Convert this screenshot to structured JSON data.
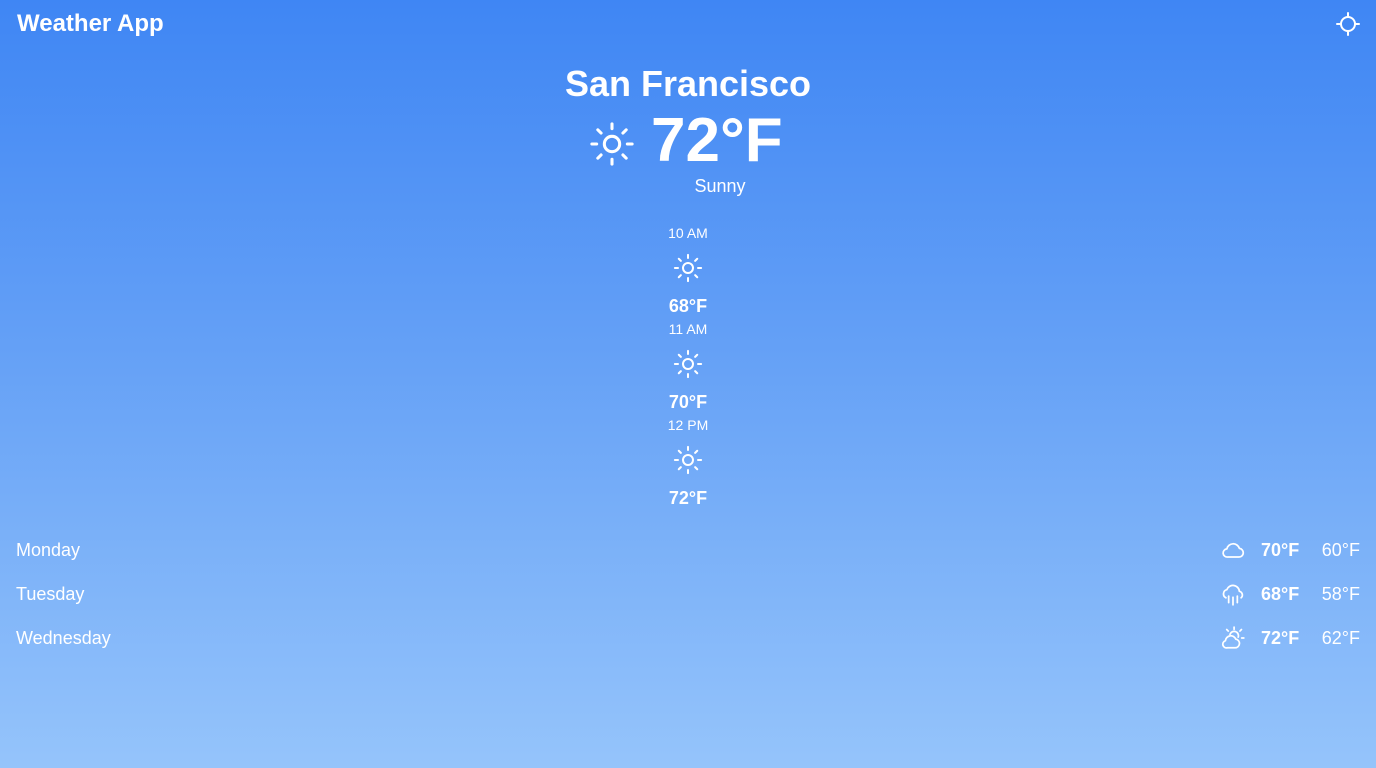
{
  "app": {
    "title": "Weather App",
    "locate_icon": "crosshair-icon"
  },
  "current": {
    "city": "San Francisco",
    "temperature": "72°F",
    "condition": "Sunny",
    "icon": "sun-icon"
  },
  "hourly": [
    {
      "time": "10 AM",
      "icon": "sun-icon",
      "temp": "68°F"
    },
    {
      "time": "11 AM",
      "icon": "sun-icon",
      "temp": "70°F"
    },
    {
      "time": "12 PM",
      "icon": "sun-icon",
      "temp": "72°F"
    }
  ],
  "daily": [
    {
      "day": "Monday",
      "icon": "cloud-icon",
      "high": "70°F",
      "low": "60°F"
    },
    {
      "day": "Tuesday",
      "icon": "cloud-rain-icon",
      "high": "68°F",
      "low": "58°F"
    },
    {
      "day": "Wednesday",
      "icon": "cloud-sun-icon",
      "high": "72°F",
      "low": "62°F"
    }
  ],
  "colors": {
    "gradient_top": "#3f86f4",
    "gradient_bottom": "#95c4fb",
    "text": "#ffffff"
  }
}
